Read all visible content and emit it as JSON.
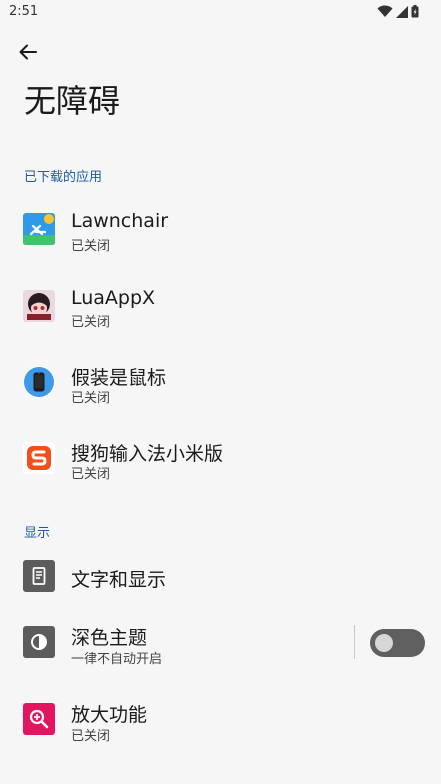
{
  "status": {
    "time": "2:51"
  },
  "page": {
    "title": "无障碍"
  },
  "sections": {
    "downloaded": "已下载的应用",
    "display": "显示"
  },
  "apps": [
    {
      "label": "Lawnchair",
      "sub": "已关闭",
      "icon": "lawnchair-app-icon"
    },
    {
      "label": "LuaAppX",
      "sub": "已关闭",
      "icon": "luaappx-app-icon"
    },
    {
      "label": "假装是鼠标",
      "sub": "已关闭",
      "icon": "phone-app-icon"
    },
    {
      "label": "搜狗输入法小米版",
      "sub": "已关闭",
      "icon": "sogou-app-icon"
    }
  ],
  "display_items": [
    {
      "label": "文字和显示",
      "icon": "text-display-icon"
    },
    {
      "label": "深色主题",
      "sub": "一律不自动开启",
      "icon": "dark-theme-icon",
      "toggle": false
    },
    {
      "label": "放大功能",
      "sub": "已关闭",
      "icon": "magnify-icon"
    }
  ],
  "colors": {
    "accent": "#1b5aa6",
    "background": "#f6f6f6",
    "magnify": "#e3155f",
    "gray_icon": "#5c5c5c"
  }
}
